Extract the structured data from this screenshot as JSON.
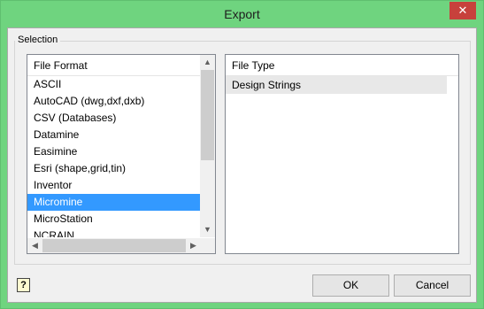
{
  "window": {
    "title": "Export",
    "close_glyph": "✕"
  },
  "selection": {
    "label": "Selection",
    "file_format": {
      "header": "File Format",
      "items": [
        "ASCII",
        "AutoCAD (dwg,dxf,dxb)",
        "CSV (Databases)",
        "Datamine",
        "Easimine",
        "Esri (shape,grid,tin)",
        "Inventor",
        "Micromine",
        "MicroStation",
        "NCRAIN"
      ],
      "selected": "Micromine"
    },
    "file_type": {
      "header": "File Type",
      "items": [
        "Design Strings"
      ]
    }
  },
  "buttons": {
    "ok": "OK",
    "cancel": "Cancel"
  },
  "icons": {
    "help": "?"
  }
}
